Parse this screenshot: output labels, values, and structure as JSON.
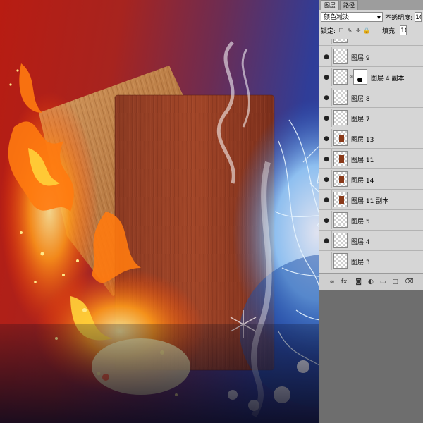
{
  "panel": {
    "tabs": [
      {
        "label": "图层",
        "active": true
      },
      {
        "label": "路径",
        "active": false
      }
    ],
    "blend_mode": "颜色减淡",
    "opacity_label": "不透明度:",
    "opacity_value": "10",
    "lock_label": "锁定:",
    "fill_label": "填充:",
    "fill_value": "10",
    "layers": [
      {
        "name": "图层 9",
        "visible": true,
        "thumb": "empty",
        "mask": false
      },
      {
        "name": "图层 4 副本",
        "visible": true,
        "thumb": "empty",
        "mask": true
      },
      {
        "name": "图层 8",
        "visible": true,
        "thumb": "empty",
        "mask": false
      },
      {
        "name": "图层 7",
        "visible": true,
        "thumb": "empty",
        "mask": false
      },
      {
        "name": "图层 13",
        "visible": true,
        "thumb": "board",
        "mask": false
      },
      {
        "name": "图层 11",
        "visible": true,
        "thumb": "board",
        "mask": false
      },
      {
        "name": "图层 14",
        "visible": true,
        "thumb": "board",
        "mask": false
      },
      {
        "name": "图层 11 副本",
        "visible": true,
        "thumb": "board",
        "mask": false
      },
      {
        "name": "图层 5",
        "visible": true,
        "thumb": "empty",
        "mask": false
      },
      {
        "name": "图层 4",
        "visible": true,
        "thumb": "empty",
        "mask": false
      },
      {
        "name": "图层 3",
        "visible": false,
        "thumb": "empty",
        "mask": false
      }
    ],
    "bottom_icons": [
      "link-icon",
      "fx-icon",
      "mask-icon",
      "adjustment-icon",
      "folder-icon",
      "new-layer-icon",
      "trash-icon"
    ],
    "bottom_fx_label": "fx."
  }
}
